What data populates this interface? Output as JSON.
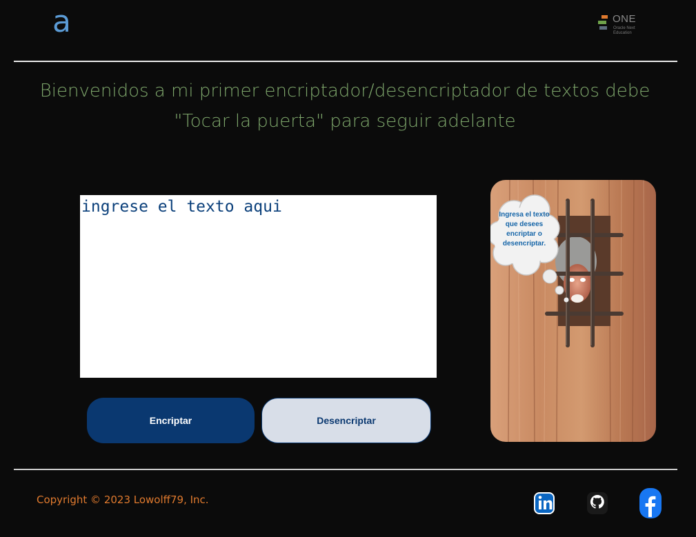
{
  "header": {
    "alura_logo_glyph": "a",
    "one_logo": {
      "word": "ONE",
      "subtitle": "Oracle Next Education"
    }
  },
  "main": {
    "title": "Bienvenidos a mi primer encriptador/desencriptador de textos debe \"Tocar la puerta\" para seguir adelante",
    "text_input": {
      "value": "",
      "placeholder": "ingrese el texto aqui"
    },
    "buttons": {
      "encrypt_label": "Encriptar",
      "decrypt_label": "Desencriptar"
    },
    "door_image": {
      "bubble_text": "Ingresa el texto que desees encriptar o desencriptar."
    }
  },
  "footer": {
    "copyright": "Copyright © 2023 Lowolff79, Inc.",
    "social_icons": [
      "linkedin-icon",
      "github-icon",
      "facebook-icon"
    ]
  },
  "colors": {
    "background": "#0b0b0b",
    "title": "#7fa86c",
    "primary_button": "#0a3870",
    "secondary_button": "#d8dee8",
    "copyright": "#e07a2e",
    "logo_blue": "#5b9bd5"
  }
}
